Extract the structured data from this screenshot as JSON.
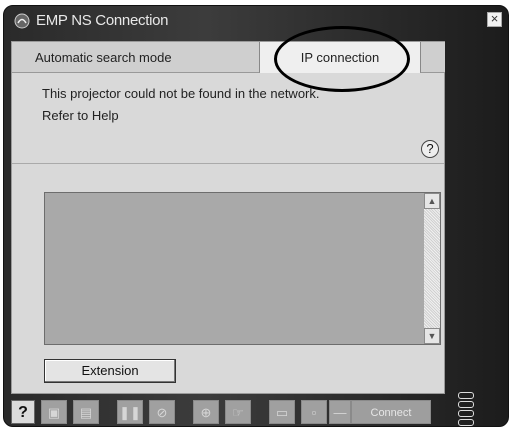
{
  "window": {
    "title": "EMP NS Connection",
    "close_label": "×"
  },
  "tabs": [
    {
      "label": "Automatic search mode"
    },
    {
      "label": "IP connection"
    }
  ],
  "messages": {
    "line1": "This projector could not be found in the network.",
    "line2": "Refer to Help",
    "help_symbol": "?"
  },
  "list": {
    "scroll_up": "▲",
    "scroll_down": "▼"
  },
  "extension_button": "Extension",
  "toolbar": {
    "help": "?",
    "connect": "Connect",
    "icons": [
      "monitor-icon",
      "document-icon",
      "pause-icon",
      "no-image-icon",
      "zoom-icon",
      "hand-icon",
      "display-icon",
      "mute-icon",
      "cable-icon"
    ]
  },
  "colors": {
    "window_bg": "#2a2a2a",
    "panel_bg": "#d9d9d9",
    "list_bg": "#a9a9a9",
    "active_tab_bg": "#efefef"
  }
}
